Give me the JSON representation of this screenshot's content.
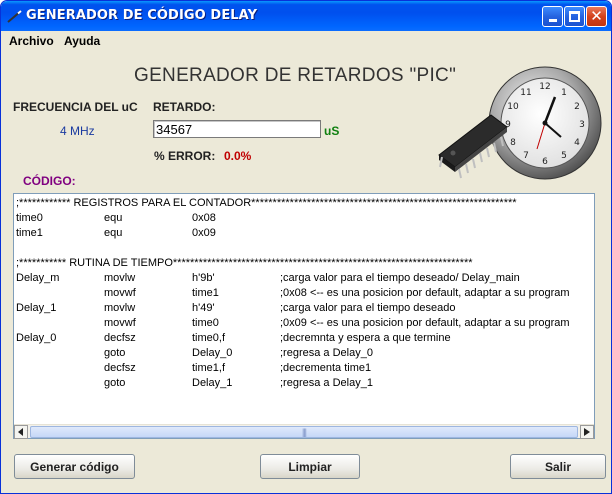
{
  "window": {
    "title": "GENERADOR DE CÓDIGO DELAY"
  },
  "menu": [
    {
      "label": "Archivo"
    },
    {
      "label": "Ayuda"
    }
  ],
  "form": {
    "heading": "GENERADOR DE RETARDOS \"PIC\"",
    "frequency_label": "FRECUENCIA DEL uC",
    "frequency_value": "4 MHz",
    "delay_label": "RETARDO:",
    "delay_value": "34567",
    "delay_unit": "uS",
    "error_label": "% ERROR:",
    "error_value": "0.0%",
    "code_label": "CÓDIGO:"
  },
  "code_lines": [
    {
      "full": ";************ REGISTROS PARA EL CONTADOR**************************************************************"
    },
    {
      "label": "time0",
      "op": "equ",
      "arg": "0x08",
      "comment": ""
    },
    {
      "label": "time1",
      "op": "equ",
      "arg": "0x09",
      "comment": ""
    },
    {
      "full": ""
    },
    {
      "full": ";*********** RUTINA DE TIEMPO**********************************************************************"
    },
    {
      "label": "Delay_m",
      "op": "movlw",
      "arg": "h'9b'",
      "comment": ";carga valor para el tiempo deseado/ Delay_main"
    },
    {
      "label": "",
      "op": "movwf",
      "arg": "time1",
      "comment": ";0x08 <-- es una posicion por default, adaptar a su program"
    },
    {
      "label": "Delay_1",
      "op": "movlw",
      "arg": "h'49'",
      "comment": ";carga valor para el tiempo deseado"
    },
    {
      "label": "",
      "op": "movwf",
      "arg": "time0",
      "comment": ";0x09 <-- es una posicion por default, adaptar a su program"
    },
    {
      "label": "Delay_0",
      "op": "decfsz",
      "arg": "time0,f",
      "comment": ";decremnta y espera a que termine"
    },
    {
      "label": "",
      "op": "goto",
      "arg": "Delay_0",
      "comment": ";regresa a Delay_0"
    },
    {
      "label": "",
      "op": "decfsz",
      "arg": "time1,f",
      "comment": ";decrementa time1"
    },
    {
      "label": "",
      "op": "goto",
      "arg": "Delay_1",
      "comment": ";regresa a Delay_1"
    }
  ],
  "buttons": {
    "generate": "Generar código",
    "clear": "Limpiar",
    "exit": "Salir"
  },
  "icons": {
    "title": "wand-icon",
    "minimize": "minimize-icon",
    "maximize": "maximize-icon",
    "close": "close-icon",
    "illustration": "pic-chip-clock-illustration",
    "scroll_left": "arrow-left-icon",
    "scroll_right": "arrow-right-icon"
  },
  "colors": {
    "titlebar": "#0053ee",
    "frequency_value": "#1a3aa0",
    "unit": "#108010",
    "error_value": "#c00000",
    "code_label": "#800080"
  }
}
